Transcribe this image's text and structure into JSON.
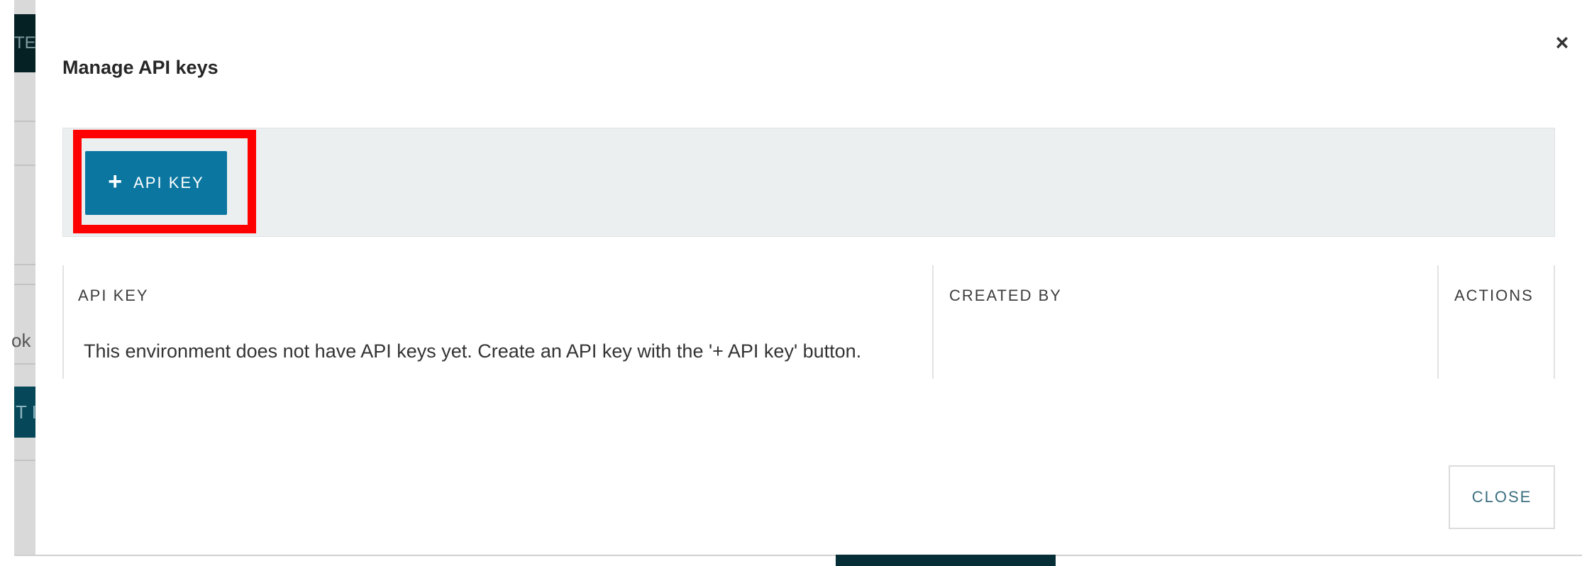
{
  "background": {
    "topbar_fragment": "TE",
    "text_fragment": "ok",
    "button_fragment": "T I"
  },
  "modal": {
    "title": "Manage API keys",
    "close_icon": "close-icon",
    "add_button": {
      "icon": "plus-icon",
      "label": "API KEY"
    },
    "table": {
      "columns": [
        "API KEY",
        "CREATED BY",
        "ACTIONS"
      ],
      "empty_message": "This environment does not have API keys yet. Create an API key with the '+ API key' button."
    },
    "footer": {
      "close_label": "CLOSE"
    }
  },
  "colors": {
    "primary": "#0b77a1",
    "highlight": "#ff0000",
    "toolbar_bg": "#eceff0"
  }
}
